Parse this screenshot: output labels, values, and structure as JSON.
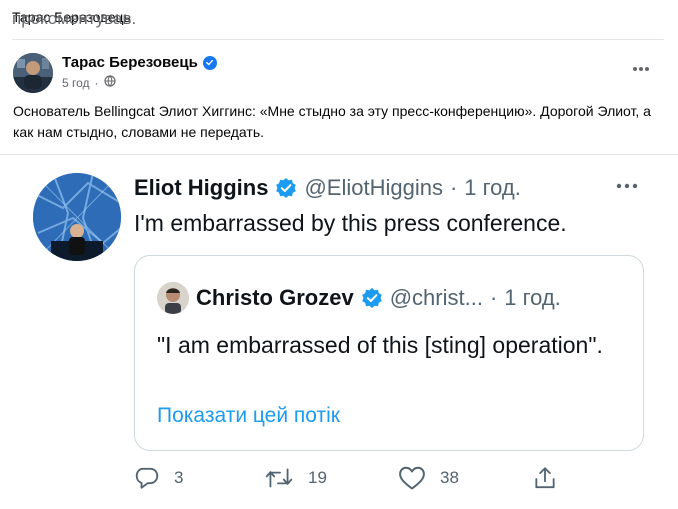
{
  "activity": {
    "actor": "Тарас Березовець",
    "action": "прокоментував."
  },
  "post": {
    "author": "Тарас Березовець",
    "time": "5 год",
    "text": "Основатель Bellingcat Элиот Хиггинс: «Мне стыдно за эту пресс-конференцию». Дорогой Элиот, а как нам стыдно, словами не передать."
  },
  "tweet": {
    "name": "Eliot Higgins",
    "handle": "@EliotHiggins",
    "separator": "·",
    "time": "1 год.",
    "text": "I'm embarrassed by this press conference.",
    "quoted": {
      "name": "Christo Grozev",
      "handle": "@christ...",
      "separator": "·",
      "time": "1 год.",
      "text": "\"I am embarrassed of this [sting] operation\".",
      "show_thread": "Показати цей потік"
    },
    "actions": {
      "replies": "3",
      "retweets": "19",
      "likes": "38"
    }
  },
  "colors": {
    "facebook_blue": "#1877f2",
    "twitter_blue": "#1d9bf0",
    "muted_text": "#65676b",
    "twitter_muted": "#536471"
  },
  "icons": {
    "post_verified": "verified-badge-icon",
    "post_menu": "more-horizontal-icon",
    "time_privacy": "globe-icon",
    "reply": "reply-icon",
    "retweet": "retweet-icon",
    "like": "heart-icon",
    "share": "share-icon"
  }
}
